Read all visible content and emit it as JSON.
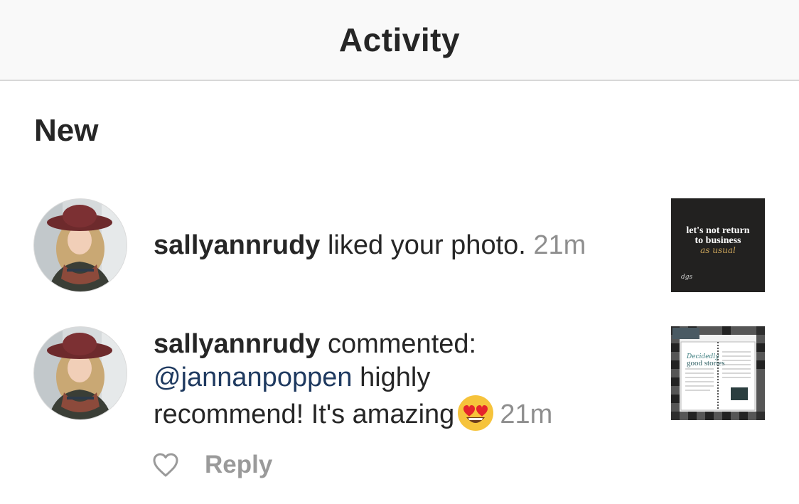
{
  "header": {
    "title": "Activity"
  },
  "section": {
    "title": "New"
  },
  "notifications": [
    {
      "username": "sallyannrudy",
      "action": "liked your photo.",
      "time": "21m",
      "avatar_icon": "user-avatar",
      "thumbnail": {
        "line1": "let's not return",
        "line2": "to business",
        "script": "as usual",
        "logo": "dgs"
      }
    },
    {
      "username": "sallyannrudy",
      "action": "commented:",
      "mention": "@jannanpoppen",
      "comment_part1": "highly",
      "comment_part2": "recommend! It's amazing",
      "emoji": "heart-eyes-emoji",
      "time": "21m",
      "avatar_icon": "user-avatar",
      "thumbnail": {
        "title_script": "Decidedly",
        "title": "good stories"
      },
      "actions": {
        "like_icon": "heart-outline-icon",
        "reply_label": "Reply"
      }
    }
  ],
  "colors": {
    "header_bg": "#f9f9f9",
    "text": "#262626",
    "muted": "#8e8e8e",
    "mention": "#1f3a60",
    "reply": "#9a9a9a"
  }
}
